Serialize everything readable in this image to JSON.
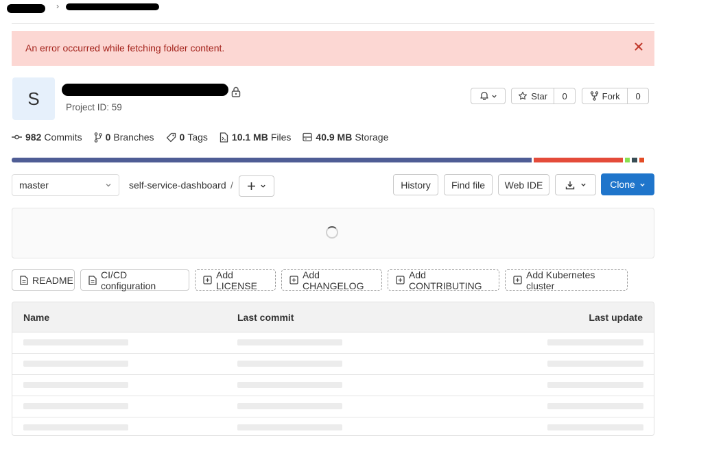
{
  "breadcrumb": {
    "separator": "›"
  },
  "alert": {
    "message": "An error occurred while fetching folder content."
  },
  "project": {
    "avatar_letter": "S",
    "id_label": "Project ID: 59"
  },
  "actions": {
    "star_label": "Star",
    "star_count": "0",
    "fork_label": "Fork",
    "fork_count": "0"
  },
  "stats": [
    {
      "icon": "commit-icon",
      "value": "982",
      "label": "Commits"
    },
    {
      "icon": "branch-icon",
      "value": "0",
      "label": "Branches"
    },
    {
      "icon": "tag-icon",
      "value": "0",
      "label": "Tags"
    },
    {
      "icon": "file-icon",
      "value": "10.1 MB",
      "label": "Files"
    },
    {
      "icon": "storage-icon",
      "value": "40.9 MB",
      "label": "Storage"
    }
  ],
  "languages": [
    {
      "color": "#4f5d95",
      "share": 0.82
    },
    {
      "color": "#e44b3a",
      "share": 0.14
    },
    {
      "color": "#89e051",
      "share": 0.008
    },
    {
      "color": "#384d54",
      "share": 0.008
    },
    {
      "color": "#e34c26",
      "share": 0.008
    }
  ],
  "toolbar": {
    "branch": "master",
    "path": "self-service-dashboard",
    "path_sep": "/",
    "history": "History",
    "find_file": "Find file",
    "web_ide": "Web IDE",
    "clone": "Clone"
  },
  "quick_actions": {
    "readme": "README",
    "cicd": "CI/CD configuration",
    "license": "Add LICENSE",
    "changelog": "Add CHANGELOG",
    "contributing": "Add CONTRIBUTING",
    "kubernetes": "Add Kubernetes cluster"
  },
  "table": {
    "headers": {
      "name": "Name",
      "last_commit": "Last commit",
      "last_update": "Last update"
    },
    "loading_rows": 5
  },
  "colors": {
    "accent": "#1f75cb",
    "alert_bg": "#fcd7d3",
    "alert_text": "#a3211a"
  }
}
